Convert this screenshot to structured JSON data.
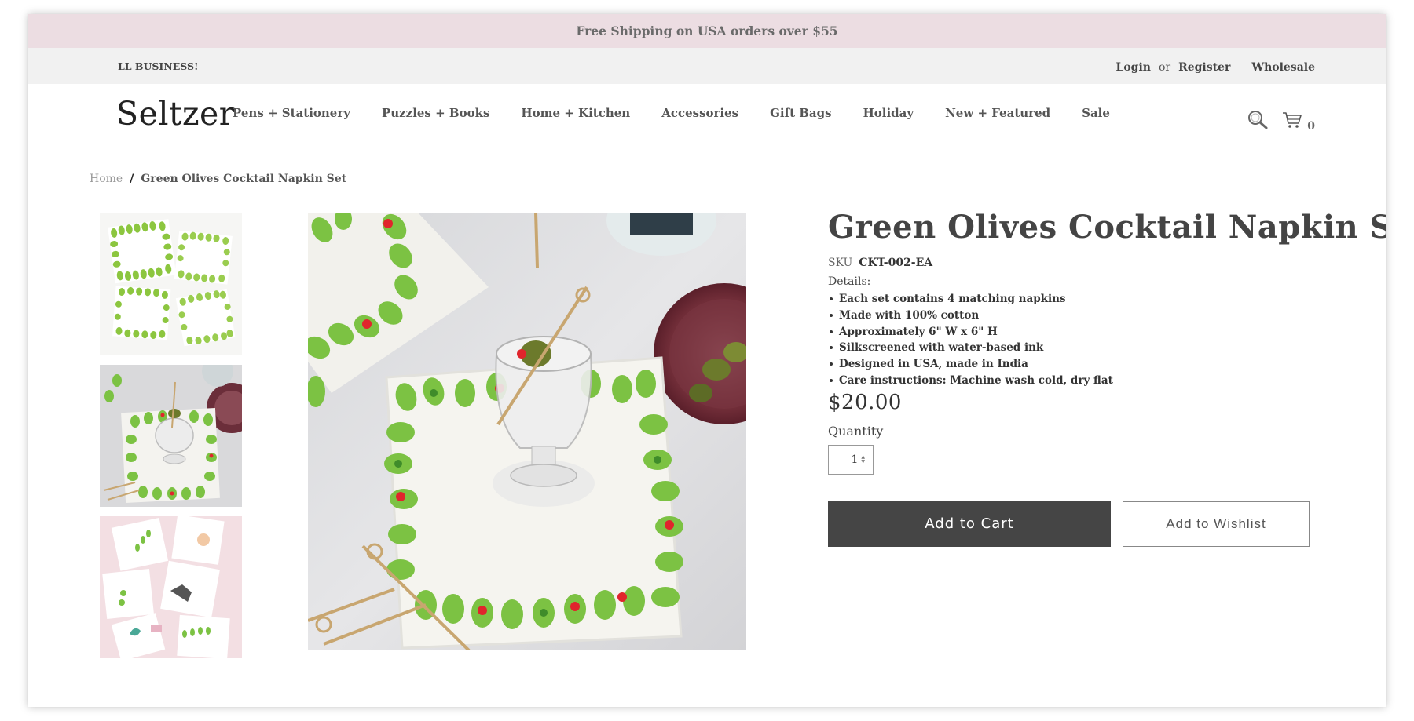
{
  "promo": {
    "text": "Free Shipping on USA orders over $55"
  },
  "utility": {
    "left_text": "LL BUSINESS!",
    "login": "Login",
    "or": "or",
    "register": "Register",
    "wholesale": "Wholesale"
  },
  "header": {
    "logo": "Seltzer",
    "nav": [
      "Pens + Stationery",
      "Puzzles + Books",
      "Home + Kitchen",
      "Accessories",
      "Gift Bags",
      "Holiday",
      "New + Featured",
      "Sale"
    ],
    "icons": {
      "search": "search-icon",
      "cart": "cart-icon"
    },
    "cart_count": "0"
  },
  "breadcrumb": {
    "home": "Home",
    "separator": "/",
    "current": "Green Olives Cocktail Napkin Set"
  },
  "product": {
    "title": "Green Olives Cocktail Napkin Set",
    "sku_label": "SKU",
    "sku": "CKT-002-EA",
    "details_label": "Details:",
    "details": [
      "Each set contains 4 matching napkins",
      "Made with 100% cotton",
      "Approximately 6\" W x 6\" H",
      "Silkscreened with water-based ink",
      "Designed in USA, made in India",
      "Care instructions: Machine wash cold, dry flat"
    ],
    "price": "$20.00",
    "quantity_label": "Quantity",
    "quantity": "1",
    "add_to_cart": "Add to Cart",
    "add_to_wishlist": "Add to Wishlist"
  },
  "colors": {
    "promo_bg": "#ecdde2",
    "util_bg": "#f1f1f1",
    "cart_button": "#454545",
    "olive_green": "#7cc243",
    "pimento_red": "#e0252c"
  }
}
